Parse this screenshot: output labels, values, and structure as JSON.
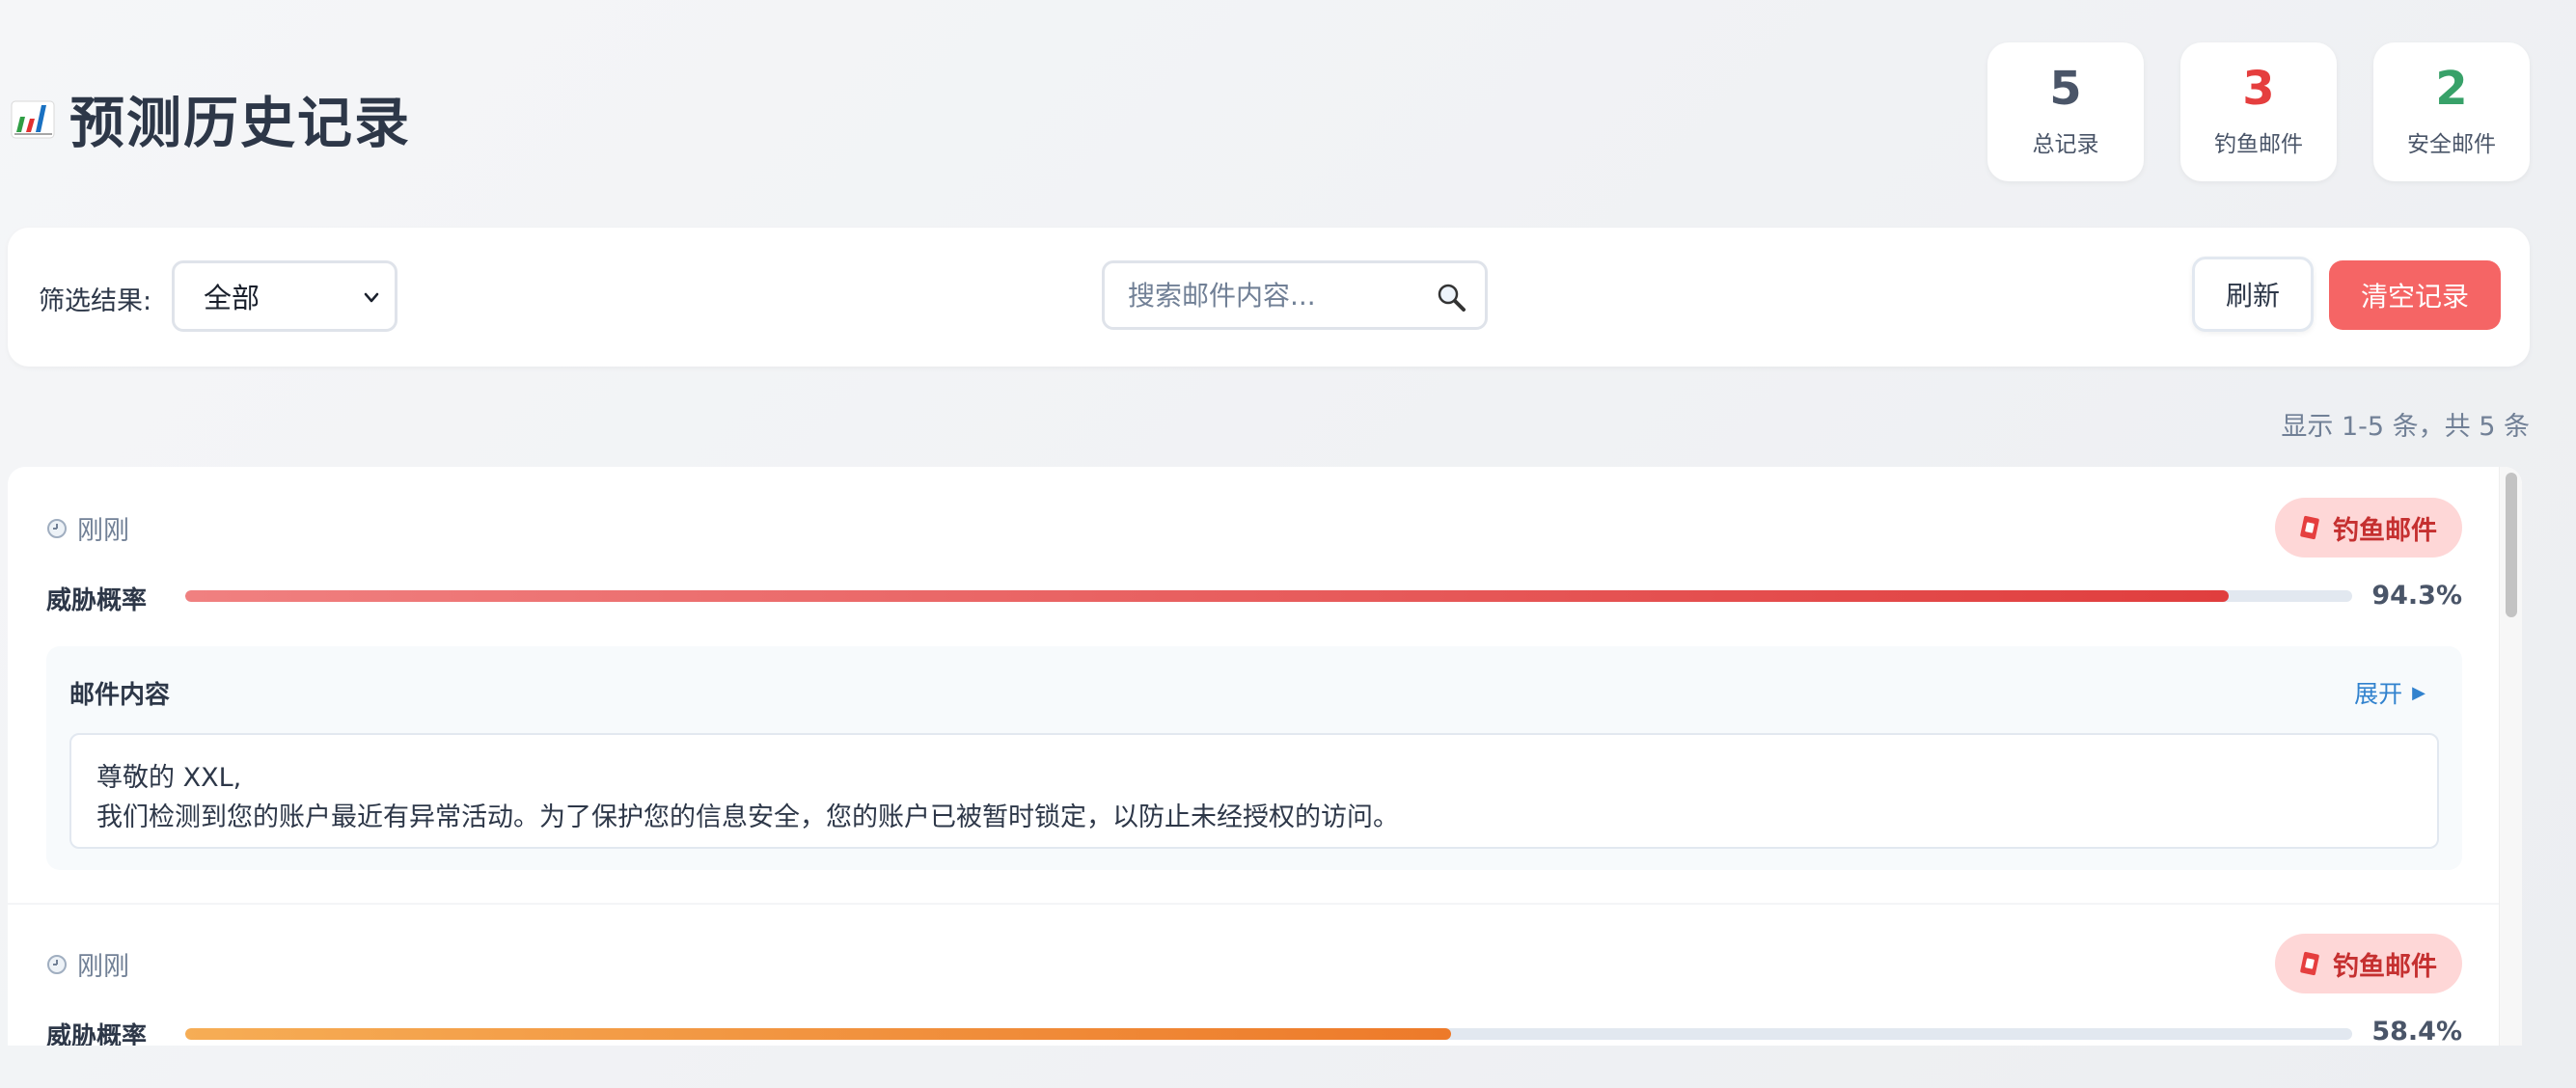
{
  "header": {
    "title": "预测历史记录",
    "icon": "bar-chart-icon"
  },
  "stats": [
    {
      "value": "5",
      "label": "总记录",
      "color": "#4a5568"
    },
    {
      "value": "3",
      "label": "钓鱼邮件",
      "color": "#e53e3e"
    },
    {
      "value": "2",
      "label": "安全邮件",
      "color": "#38a169"
    }
  ],
  "toolbar": {
    "filter_label": "筛选结果:",
    "filter_value": "全部",
    "search_placeholder": "搜索邮件内容...",
    "refresh_label": "刷新",
    "clear_label": "清空记录"
  },
  "pagination": {
    "summary": "显示 1-5 条，共 5 条"
  },
  "records": [
    {
      "time": "刚刚",
      "badge": "钓鱼邮件",
      "threat_label": "威胁概率",
      "threat_value": "94.3%",
      "threat_fraction": 0.943,
      "content_title": "邮件内容",
      "expand_label": "展开",
      "content_lines": [
        "尊敬的 XXL,",
        "我们检测到您的账户最近有异常活动。为了保护您的信息安全，您的账户已被暂时锁定，以防止未经授权的访问。"
      ]
    },
    {
      "time": "刚刚",
      "badge": "钓鱼邮件",
      "threat_label": "威胁概率",
      "threat_value": "58.4%",
      "threat_fraction": 0.584
    }
  ],
  "colors": {
    "danger": "#f56565",
    "badge_bg": "#fed7d7",
    "badge_text": "#c53030",
    "link": "#3182ce"
  }
}
